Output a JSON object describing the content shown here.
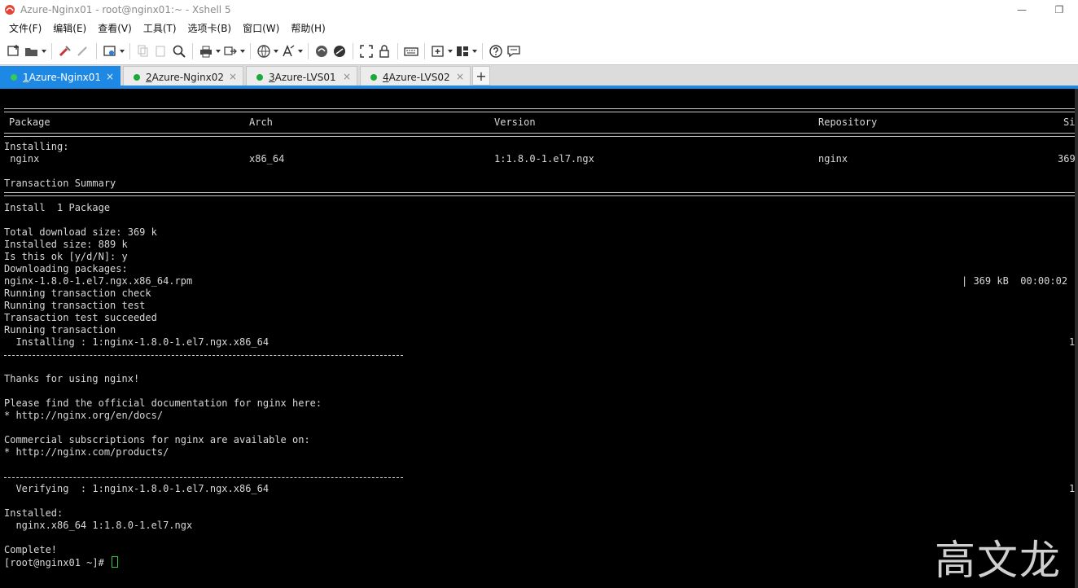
{
  "window": {
    "title": "Azure-Nginx01 - root@nginx01:~ - Xshell 5",
    "minimize_glyph": "—",
    "restore_glyph": "❐"
  },
  "menu": [
    {
      "label": "文件(F)"
    },
    {
      "label": "编辑(E)"
    },
    {
      "label": "查看(V)"
    },
    {
      "label": "工具(T)"
    },
    {
      "label": "选项卡(B)"
    },
    {
      "label": "窗口(W)"
    },
    {
      "label": "帮助(H)"
    }
  ],
  "toolbar_icons": [
    "new-session-icon",
    "open-folder-icon",
    "reconnect-icon",
    "disconnect-icon",
    "properties-icon",
    "copy-icon",
    "paste-icon",
    "find-icon",
    "print-icon",
    "transfer-icon",
    "globe-icon",
    "font-icon",
    "xftp-icon",
    "xmanager-icon",
    "fullscreen-icon",
    "lock-icon",
    "keyboard-icon",
    "add-tab-icon",
    "layout-icon",
    "help-icon",
    "chat-icon"
  ],
  "tabs": [
    {
      "number": "1",
      "label": " Azure-Nginx01",
      "active": true,
      "status_color": "#33cc55"
    },
    {
      "number": "2",
      "label": " Azure-Nginx02",
      "active": false,
      "status_color": "#1aaa3a"
    },
    {
      "number": "3",
      "label": " Azure-LVS01",
      "active": false,
      "status_color": "#1aaa3a"
    },
    {
      "number": "4",
      "label": " Azure-LVS02",
      "active": false,
      "status_color": "#1aaa3a"
    }
  ],
  "tab_close_glyph": "×",
  "tab_add_glyph": "+",
  "terminal": {
    "header": {
      "package": "Package",
      "arch": "Arch",
      "version": "Version",
      "repository": "Repository",
      "size": "Si"
    },
    "installing_label": "Installing:",
    "package_row": {
      "package": " nginx",
      "arch": "x86_64",
      "version": "1:1.8.0-1.el7.ngx",
      "repository": "nginx",
      "size": "369"
    },
    "transaction_summary": "Transaction Summary",
    "install_count": "Install  1 Package",
    "total_download": "Total download size: 369 k",
    "installed_size": "Installed size: 889 k",
    "confirm_prompt": "Is this ok [y/d/N]: y",
    "downloading": "Downloading packages:",
    "rpm_file": "nginx-1.8.0-1.el7.ngx.x86_64.rpm",
    "rpm_progress": "| 369 kB  00:00:02",
    "check": "Running transaction check",
    "test": "Running transaction test",
    "test_ok": "Transaction test succeeded",
    "running": "Running transaction",
    "installing_step": "  Installing : 1:nginx-1.8.0-1.el7.ngx.x86_64",
    "installing_step_count": "1",
    "thanks": "Thanks for using nginx!",
    "docs_intro": "Please find the official documentation for nginx here:",
    "docs_url": "* http://nginx.org/en/docs/",
    "commercial_intro": "Commercial subscriptions for nginx are available on:",
    "commercial_url": "* http://nginx.com/products/",
    "verifying_step": "  Verifying  : 1:nginx-1.8.0-1.el7.ngx.x86_64",
    "verifying_step_count": "1",
    "installed_label": "Installed:",
    "installed_pkg": "  nginx.x86_64 1:1.8.0-1.el7.ngx",
    "complete": "Complete!",
    "prompt": "[root@nginx01 ~]# "
  },
  "watermark": "高文龙",
  "colors": {
    "accent": "#1e88e5",
    "terminal_bg": "#000000",
    "terminal_fg": "#d8d8d8",
    "cursor": "#2ecc40"
  }
}
